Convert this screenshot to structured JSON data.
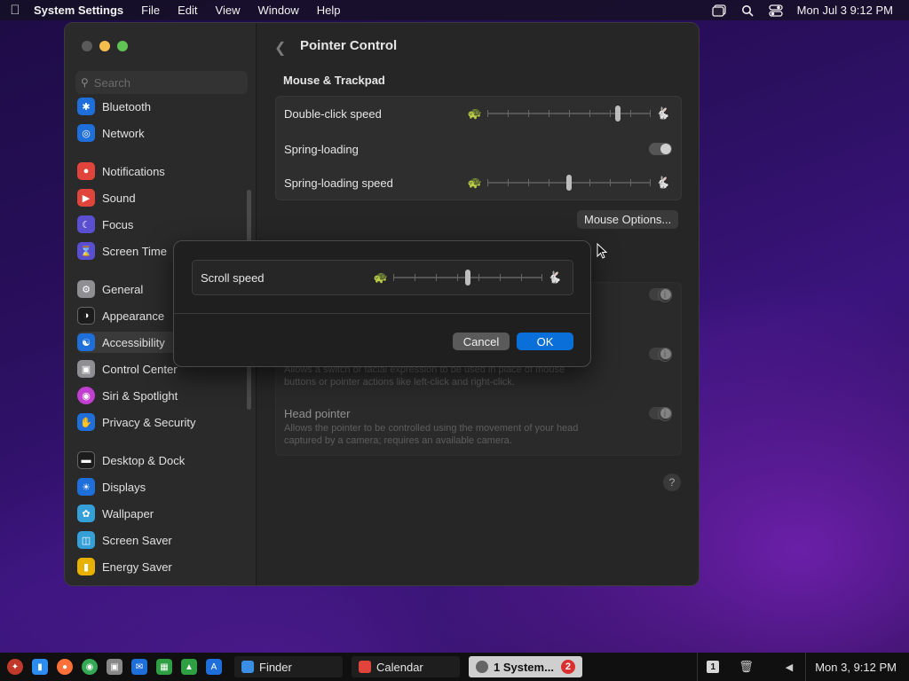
{
  "menubar": {
    "app_name": "System Settings",
    "menus": [
      "File",
      "Edit",
      "View",
      "Window",
      "Help"
    ],
    "clock": "Mon Jul 3  9:12 PM"
  },
  "window": {
    "search_placeholder": "Search",
    "sidebar": {
      "items": [
        {
          "label": "Bluetooth",
          "icon": "bluetooth-icon",
          "color": "#1e6fd9"
        },
        {
          "label": "Network",
          "icon": "globe-icon",
          "color": "#1e6fd9"
        },
        {
          "label": "Notifications",
          "icon": "bell-icon",
          "color": "#e0443b"
        },
        {
          "label": "Sound",
          "icon": "speaker-icon",
          "color": "#e0443b"
        },
        {
          "label": "Focus",
          "icon": "moon-icon",
          "color": "#5b4fd1"
        },
        {
          "label": "Screen Time",
          "icon": "hourglass-icon",
          "color": "#5b4fd1"
        },
        {
          "label": "General",
          "icon": "gear-icon",
          "color": "#8e8e93"
        },
        {
          "label": "Appearance",
          "icon": "appearance-icon",
          "color": "#1c1c1c"
        },
        {
          "label": "Accessibility",
          "icon": "accessibility-icon",
          "color": "#1e6fd9"
        },
        {
          "label": "Control Center",
          "icon": "control-center-icon",
          "color": "#8e8e93"
        },
        {
          "label": "Siri & Spotlight",
          "icon": "siri-icon",
          "color": "#c13fd0"
        },
        {
          "label": "Privacy & Security",
          "icon": "hand-icon",
          "color": "#1e6fd9"
        },
        {
          "label": "Desktop & Dock",
          "icon": "dock-icon",
          "color": "#1c1c1c"
        },
        {
          "label": "Displays",
          "icon": "sun-icon",
          "color": "#1e6fd9"
        },
        {
          "label": "Wallpaper",
          "icon": "wallpaper-icon",
          "color": "#35a0d8"
        },
        {
          "label": "Screen Saver",
          "icon": "screensaver-icon",
          "color": "#35a0d8"
        },
        {
          "label": "Energy Saver",
          "icon": "battery-icon",
          "color": "#e8b100"
        }
      ],
      "selected": "Accessibility"
    },
    "page_title": "Pointer Control",
    "section_title": "Mouse & Trackpad",
    "rows": {
      "double_click_speed": {
        "label": "Double-click speed",
        "value_fraction": 0.8
      },
      "spring_loading": {
        "label": "Spring-loading",
        "enabled": true
      },
      "spring_loading_speed": {
        "label": "Spring-loading speed",
        "value_fraction": 0.5
      }
    },
    "mouse_options_label": "Mouse Options...",
    "alt_control": {
      "desc_partial": "Allows a switch or facial expression to be used in place of mouse buttons or pointer actions like left-click and right-click.",
      "head_pointer_label": "Head pointer",
      "head_pointer_desc": "Allows the pointer to be controlled using the movement of your head captured by a camera; requires an available camera."
    },
    "help_label": "?"
  },
  "dialog": {
    "label": "Scroll speed",
    "value_fraction": 0.5,
    "cancel": "Cancel",
    "ok": "OK"
  },
  "taskbar": {
    "tasks": [
      {
        "label": "Finder",
        "active": false
      },
      {
        "label": "Calendar",
        "active": false
      },
      {
        "label": "1 System...",
        "active": true,
        "badge": "2"
      }
    ],
    "workspace": "1",
    "clock": "Mon 3, 9:12 PM"
  }
}
